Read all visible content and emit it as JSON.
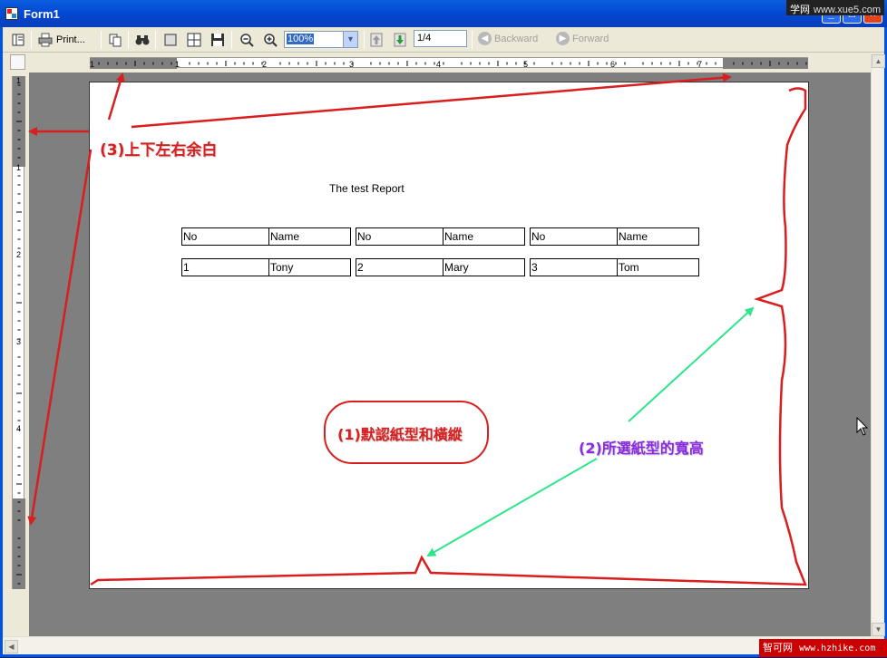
{
  "window": {
    "title": "Form1"
  },
  "watermarks": {
    "top_label": "学网",
    "top_url": "www.xue5.com",
    "bottom_label": "智可网",
    "bottom_url": "www.hzhike.com"
  },
  "toolbar": {
    "print_label": "Print...",
    "zoom_value": "100%",
    "page_value": "1/4",
    "backward_label": "Backward",
    "forward_label": "Forward"
  },
  "report": {
    "title": "The test Report",
    "header": [
      {
        "no": "No",
        "name": "Name"
      },
      {
        "no": "No",
        "name": "Name"
      },
      {
        "no": "No",
        "name": "Name"
      }
    ],
    "rows": [
      {
        "no": "1",
        "name": "Tony"
      },
      {
        "no": "2",
        "name": "Mary"
      },
      {
        "no": "3",
        "name": "Tom"
      }
    ]
  },
  "rulers": {
    "horizontal_labels": [
      "1",
      "1",
      "2",
      "3",
      "4",
      "5",
      "6",
      "7"
    ],
    "vertical_labels": [
      "1",
      "1",
      "2",
      "3",
      "4"
    ]
  },
  "annotations": {
    "margins": "(3)上下左右余白",
    "default_paper": "(1)默認紙型和橫縱",
    "selected_paper": "(2)所選紙型的寬高",
    "colors": {
      "red": "#d81e1e",
      "purple": "#8a2be2",
      "green": "#2ee58a"
    }
  }
}
